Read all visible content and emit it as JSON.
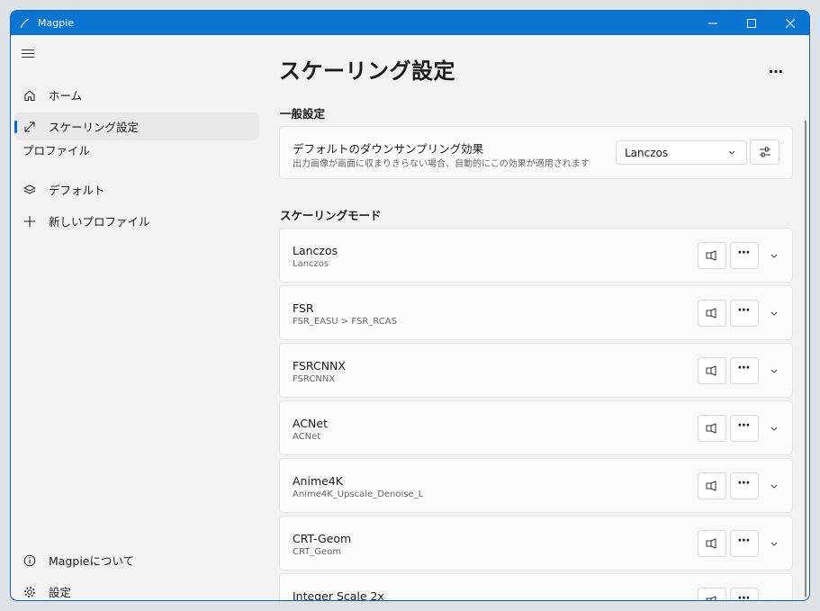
{
  "window": {
    "title": "Magpie"
  },
  "sidebar": {
    "items": [
      {
        "label": "ホーム"
      },
      {
        "label": "スケーリング設定"
      }
    ],
    "profiles_header": "プロファイル",
    "profile_items": [
      {
        "label": "デフォルト"
      },
      {
        "label": "新しいプロファイル"
      }
    ],
    "footer_items": [
      {
        "label": "Magpieについて"
      },
      {
        "label": "設定"
      }
    ]
  },
  "main": {
    "title": "スケーリング設定",
    "general_header": "一般設定",
    "downscaling": {
      "title": "デフォルトのダウンサンプリング効果",
      "description": "出力画像が画面に収まりきらない場合、自動的にこの効果が適用されます",
      "selected": "Lanczos"
    },
    "modes_header": "スケーリングモード",
    "modes": [
      {
        "name": "Lanczos",
        "effects": "Lanczos"
      },
      {
        "name": "FSR",
        "effects": "FSR_EASU > FSR_RCAS"
      },
      {
        "name": "FSRCNNX",
        "effects": "FSRCNNX"
      },
      {
        "name": "ACNet",
        "effects": "ACNet"
      },
      {
        "name": "Anime4K",
        "effects": "Anime4K_Upscale_Denoise_L"
      },
      {
        "name": "CRT-Geom",
        "effects": "CRT_Geom"
      },
      {
        "name": "Integer Scale 2x",
        "effects": ""
      }
    ]
  },
  "colors": {
    "titlebar": "#0a74d0",
    "accent": "#0a6bcc"
  }
}
